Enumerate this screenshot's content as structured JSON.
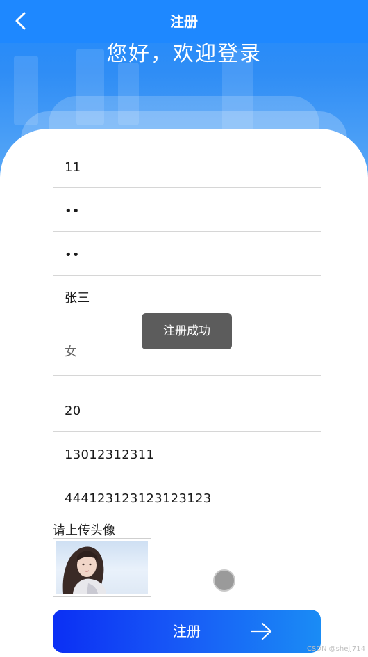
{
  "header": {
    "title": "注册",
    "welcome": "您好，欢迎登录"
  },
  "form": {
    "fields": [
      {
        "name": "account",
        "value": "11"
      },
      {
        "name": "password",
        "value": "••"
      },
      {
        "name": "confirm_password",
        "value": "••"
      },
      {
        "name": "real_name",
        "value": "张三"
      },
      {
        "name": "gender",
        "value": "女"
      },
      {
        "name": "age",
        "value": "20"
      },
      {
        "name": "phone",
        "value": "13012312311"
      },
      {
        "name": "id_number",
        "value": "444123123123123123"
      }
    ],
    "avatar_label": "请上传头像"
  },
  "submit": {
    "label": "注册"
  },
  "toast": {
    "message": "注册成功"
  },
  "watermark": "CSDN @shejj714",
  "colors": {
    "primary": "#1e88ff",
    "button_start": "#0b2ff4",
    "button_end": "#1a8cf5",
    "toast_bg": "#464646"
  }
}
